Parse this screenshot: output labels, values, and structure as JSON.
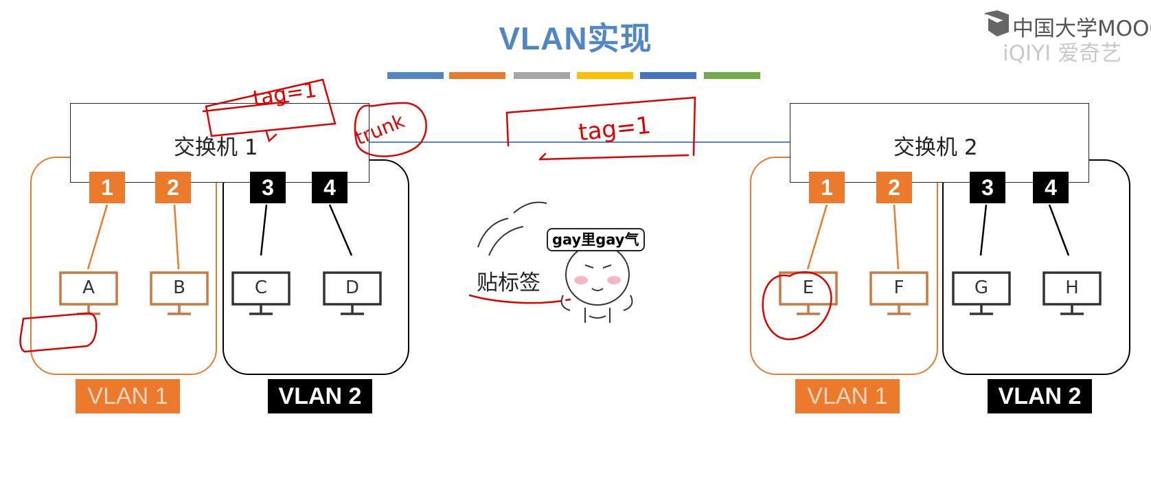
{
  "title": "VLAN实现",
  "color_bars": [
    "#4f86c6",
    "#ec7a2d",
    "#a6a6a6",
    "#ffc000",
    "#4472c4",
    "#70ad47"
  ],
  "colors": {
    "vlan1": "#ec7a2d",
    "vlan2": "#000000",
    "trunk_link": "#4f86c6",
    "annotation": "#e00000"
  },
  "logo": {
    "mooc_text": "中国大学MOOC",
    "iqiyi_text": "iQIYI 爱奇艺"
  },
  "switches": [
    {
      "label": "交换机 1",
      "ports": [
        {
          "label": "1",
          "vlan": "VLAN 1"
        },
        {
          "label": "2",
          "vlan": "VLAN 1"
        },
        {
          "label": "3",
          "vlan": "VLAN 2"
        },
        {
          "label": "4",
          "vlan": "VLAN 2"
        }
      ],
      "hosts": [
        "A",
        "B",
        "C",
        "D"
      ],
      "vlan_tags": [
        "VLAN 1",
        "VLAN 2"
      ]
    },
    {
      "label": "交换机 2",
      "ports": [
        {
          "label": "1",
          "vlan": "VLAN 1"
        },
        {
          "label": "2",
          "vlan": "VLAN 1"
        },
        {
          "label": "3",
          "vlan": "VLAN 2"
        },
        {
          "label": "4",
          "vlan": "VLAN 2"
        }
      ],
      "hosts": [
        "E",
        "F",
        "G",
        "H"
      ],
      "vlan_tags": [
        "VLAN 1",
        "VLAN 2"
      ]
    }
  ],
  "note": "贴标签",
  "meme_caption": "gay里gay气",
  "handwriting": {
    "tag1": "tag=1",
    "trunk": "trunk",
    "tag1_link": "tag=1"
  }
}
